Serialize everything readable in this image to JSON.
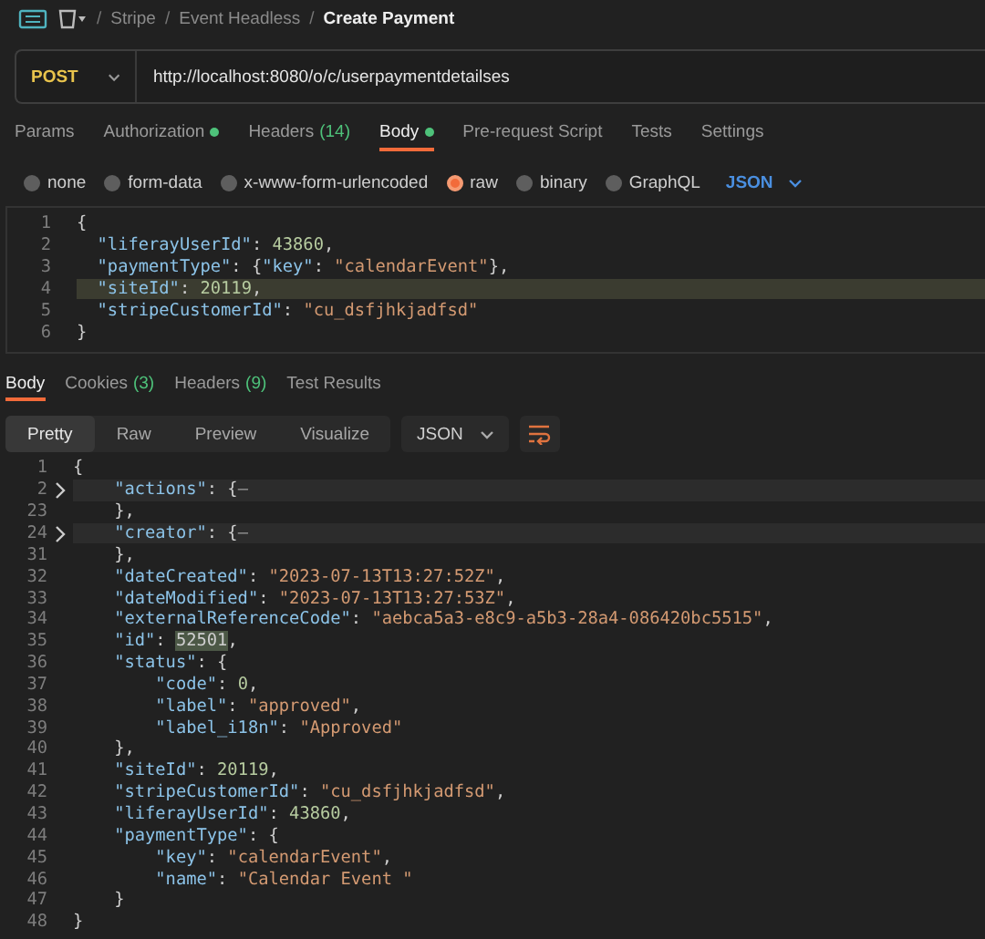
{
  "breadcrumb": {
    "separator": "/",
    "items": [
      "Stripe",
      "Event Headless",
      "Create Payment"
    ]
  },
  "request": {
    "method": "POST",
    "url": "http://localhost:8080/o/c/userpaymentdetailses",
    "tabs": [
      {
        "label": "Params",
        "dot": false,
        "selected": false
      },
      {
        "label": "Authorization",
        "dot": true,
        "selected": false
      },
      {
        "label": "Headers",
        "count": "(14)",
        "dot": false,
        "selected": false
      },
      {
        "label": "Body",
        "dot": true,
        "selected": true
      },
      {
        "label": "Pre-request Script",
        "dot": false,
        "selected": false
      },
      {
        "label": "Tests",
        "dot": false,
        "selected": false
      },
      {
        "label": "Settings",
        "dot": false,
        "selected": false
      }
    ],
    "body_types": [
      {
        "label": "none",
        "selected": false
      },
      {
        "label": "form-data",
        "selected": false
      },
      {
        "label": "x-www-form-urlencoded",
        "selected": false
      },
      {
        "label": "raw",
        "selected": true
      },
      {
        "label": "binary",
        "selected": false
      },
      {
        "label": "GraphQL",
        "selected": false
      }
    ],
    "format": "JSON",
    "lines": [
      {
        "n": "1",
        "highlighted": false,
        "tokens": [
          {
            "kind": "punct",
            "text": "{"
          }
        ]
      },
      {
        "n": "2",
        "highlighted": false,
        "tokens": [
          {
            "kind": "key",
            "text": "  \"liferayUserId\""
          },
          {
            "kind": "punct",
            "text": ": "
          },
          {
            "kind": "num",
            "text": "43860"
          },
          {
            "kind": "punct",
            "text": ","
          }
        ]
      },
      {
        "n": "3",
        "highlighted": false,
        "tokens": [
          {
            "kind": "key",
            "text": "  \"paymentType\""
          },
          {
            "kind": "punct",
            "text": ": {"
          },
          {
            "kind": "key",
            "text": "\"key\""
          },
          {
            "kind": "punct",
            "text": ": "
          },
          {
            "kind": "str",
            "text": "\"calendarEvent\""
          },
          {
            "kind": "punct",
            "text": "},"
          }
        ]
      },
      {
        "n": "4",
        "highlighted": true,
        "tokens": [
          {
            "kind": "key",
            "text": "  \"siteId\""
          },
          {
            "kind": "punct",
            "text": ": "
          },
          {
            "kind": "num",
            "text": "20119"
          },
          {
            "kind": "punct",
            "text": ","
          }
        ]
      },
      {
        "n": "5",
        "highlighted": false,
        "tokens": [
          {
            "kind": "key",
            "text": "  \"stripeCustomerId\""
          },
          {
            "kind": "punct",
            "text": ": "
          },
          {
            "kind": "str",
            "text": "\"cu_dsfjhkjadfsd\""
          }
        ]
      },
      {
        "n": "6",
        "highlighted": false,
        "tokens": [
          {
            "kind": "punct",
            "text": "}"
          }
        ]
      }
    ]
  },
  "response": {
    "tabs": [
      {
        "label": "Body",
        "selected": true
      },
      {
        "label": "Cookies",
        "count": "(3)",
        "selected": false
      },
      {
        "label": "Headers",
        "count": "(9)",
        "selected": false
      },
      {
        "label": "Test Results",
        "selected": false
      }
    ],
    "views": [
      {
        "label": "Pretty",
        "selected": true
      },
      {
        "label": "Raw",
        "selected": false
      },
      {
        "label": "Preview",
        "selected": false
      },
      {
        "label": "Visualize",
        "selected": false
      }
    ],
    "format": "JSON",
    "lines": [
      {
        "n": "1",
        "folded": false,
        "tokens": [
          {
            "kind": "punct",
            "text": "{"
          }
        ]
      },
      {
        "n": "2",
        "folded": true,
        "tokens": [
          {
            "kind": "key",
            "text": "    \"actions\""
          },
          {
            "kind": "punct",
            "text": ": {"
          },
          {
            "kind": "fold",
            "text": "–"
          }
        ]
      },
      {
        "n": "23",
        "folded": false,
        "tokens": [
          {
            "kind": "punct",
            "text": "    },"
          }
        ]
      },
      {
        "n": "24",
        "folded": true,
        "tokens": [
          {
            "kind": "key",
            "text": "    \"creator\""
          },
          {
            "kind": "punct",
            "text": ": {"
          },
          {
            "kind": "fold",
            "text": "–"
          }
        ]
      },
      {
        "n": "31",
        "folded": false,
        "tokens": [
          {
            "kind": "punct",
            "text": "    },"
          }
        ]
      },
      {
        "n": "32",
        "folded": false,
        "tokens": [
          {
            "kind": "key",
            "text": "    \"dateCreated\""
          },
          {
            "kind": "punct",
            "text": ": "
          },
          {
            "kind": "str",
            "text": "\"2023-07-13T13:27:52Z\""
          },
          {
            "kind": "punct",
            "text": ","
          }
        ]
      },
      {
        "n": "33",
        "folded": false,
        "tokens": [
          {
            "kind": "key",
            "text": "    \"dateModified\""
          },
          {
            "kind": "punct",
            "text": ": "
          },
          {
            "kind": "str",
            "text": "\"2023-07-13T13:27:53Z\""
          },
          {
            "kind": "punct",
            "text": ","
          }
        ]
      },
      {
        "n": "34",
        "folded": false,
        "tokens": [
          {
            "kind": "key",
            "text": "    \"externalReferenceCode\""
          },
          {
            "kind": "punct",
            "text": ": "
          },
          {
            "kind": "str",
            "text": "\"aebca5a3-e8c9-a5b3-28a4-086420bc5515\""
          },
          {
            "kind": "punct",
            "text": ","
          }
        ]
      },
      {
        "n": "35",
        "folded": false,
        "tokens": [
          {
            "kind": "key",
            "text": "    \"id\""
          },
          {
            "kind": "punct",
            "text": ": "
          },
          {
            "kind": "sel",
            "text": "52501"
          },
          {
            "kind": "punct",
            "text": ","
          }
        ]
      },
      {
        "n": "36",
        "folded": false,
        "tokens": [
          {
            "kind": "key",
            "text": "    \"status\""
          },
          {
            "kind": "punct",
            "text": ": {"
          }
        ]
      },
      {
        "n": "37",
        "folded": false,
        "tokens": [
          {
            "kind": "key",
            "text": "        \"code\""
          },
          {
            "kind": "punct",
            "text": ": "
          },
          {
            "kind": "num",
            "text": "0"
          },
          {
            "kind": "punct",
            "text": ","
          }
        ]
      },
      {
        "n": "38",
        "folded": false,
        "tokens": [
          {
            "kind": "key",
            "text": "        \"label\""
          },
          {
            "kind": "punct",
            "text": ": "
          },
          {
            "kind": "str",
            "text": "\"approved\""
          },
          {
            "kind": "punct",
            "text": ","
          }
        ]
      },
      {
        "n": "39",
        "folded": false,
        "tokens": [
          {
            "kind": "key",
            "text": "        \"label_i18n\""
          },
          {
            "kind": "punct",
            "text": ": "
          },
          {
            "kind": "str",
            "text": "\"Approved\""
          }
        ]
      },
      {
        "n": "40",
        "folded": false,
        "tokens": [
          {
            "kind": "punct",
            "text": "    },"
          }
        ]
      },
      {
        "n": "41",
        "folded": false,
        "tokens": [
          {
            "kind": "key",
            "text": "    \"siteId\""
          },
          {
            "kind": "punct",
            "text": ": "
          },
          {
            "kind": "num",
            "text": "20119"
          },
          {
            "kind": "punct",
            "text": ","
          }
        ]
      },
      {
        "n": "42",
        "folded": false,
        "tokens": [
          {
            "kind": "key",
            "text": "    \"stripeCustomerId\""
          },
          {
            "kind": "punct",
            "text": ": "
          },
          {
            "kind": "str",
            "text": "\"cu_dsfjhkjadfsd\""
          },
          {
            "kind": "punct",
            "text": ","
          }
        ]
      },
      {
        "n": "43",
        "folded": false,
        "tokens": [
          {
            "kind": "key",
            "text": "    \"liferayUserId\""
          },
          {
            "kind": "punct",
            "text": ": "
          },
          {
            "kind": "num",
            "text": "43860"
          },
          {
            "kind": "punct",
            "text": ","
          }
        ]
      },
      {
        "n": "44",
        "folded": false,
        "tokens": [
          {
            "kind": "key",
            "text": "    \"paymentType\""
          },
          {
            "kind": "punct",
            "text": ": {"
          }
        ]
      },
      {
        "n": "45",
        "folded": false,
        "tokens": [
          {
            "kind": "key",
            "text": "        \"key\""
          },
          {
            "kind": "punct",
            "text": ": "
          },
          {
            "kind": "str",
            "text": "\"calendarEvent\""
          },
          {
            "kind": "punct",
            "text": ","
          }
        ]
      },
      {
        "n": "46",
        "folded": false,
        "tokens": [
          {
            "kind": "key",
            "text": "        \"name\""
          },
          {
            "kind": "punct",
            "text": ": "
          },
          {
            "kind": "str",
            "text": "\"Calendar Event \""
          }
        ]
      },
      {
        "n": "47",
        "folded": false,
        "tokens": [
          {
            "kind": "punct",
            "text": "    }"
          }
        ]
      },
      {
        "n": "48",
        "folded": false,
        "tokens": [
          {
            "kind": "punct",
            "text": "}"
          }
        ]
      }
    ]
  }
}
